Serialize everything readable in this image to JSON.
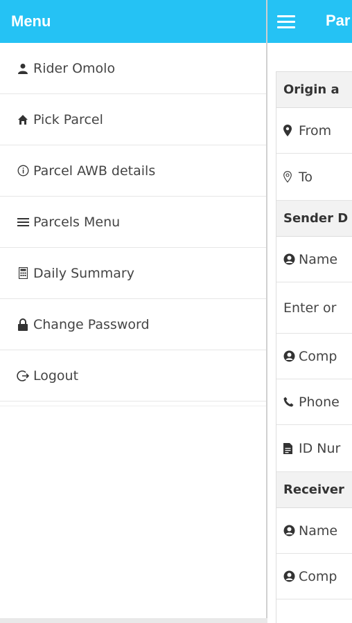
{
  "drawer": {
    "title": "Menu",
    "items": [
      {
        "label": "Rider Omolo",
        "icon": "user-icon"
      },
      {
        "label": "Pick Parcel",
        "icon": "home-icon"
      },
      {
        "label": "Parcel AWB details",
        "icon": "info-icon"
      },
      {
        "label": "Parcels Menu",
        "icon": "list-icon"
      },
      {
        "label": "Daily Summary",
        "icon": "calculator-icon"
      },
      {
        "label": "Change Password",
        "icon": "lock-icon"
      },
      {
        "label": "Logout",
        "icon": "logout-icon"
      }
    ]
  },
  "appbar": {
    "title": "Par"
  },
  "form": {
    "origin_section": "Origin a",
    "from_label": "From",
    "to_label": "To",
    "sender_section": "Sender D",
    "sender_name": "Name",
    "sender_enter": "Enter or",
    "sender_company": "Comp",
    "sender_phone": "Phone",
    "sender_id": "ID Nur",
    "receiver_section": "Receiver",
    "receiver_name": "Name",
    "receiver_company": "Comp"
  },
  "colors": {
    "accent": "#25c2f4"
  }
}
